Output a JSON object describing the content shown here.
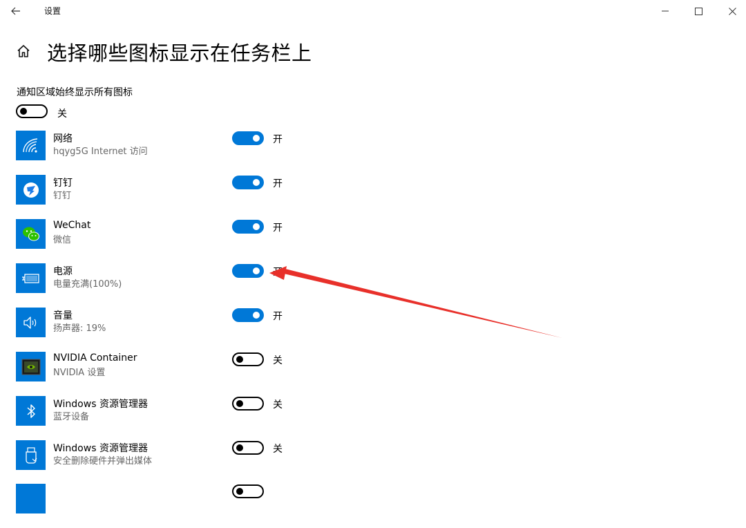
{
  "window": {
    "title": "设置",
    "controls": {
      "minimize": "minimize-icon",
      "maximize": "maximize-icon",
      "close": "close-icon"
    }
  },
  "header": {
    "title": "选择哪些图标显示在任务栏上",
    "home_icon": "home-icon"
  },
  "always_show": {
    "label": "通知区域始终显示所有图标",
    "state_label": "关",
    "on": false
  },
  "apps": [
    {
      "name": "网络",
      "description": "hqyg5G Internet 访问",
      "state_label": "开",
      "on": true,
      "icon": "wifi-icon"
    },
    {
      "name": "钉钉",
      "description": "钉钉",
      "state_label": "开",
      "on": true,
      "icon": "dingtalk-icon"
    },
    {
      "name": "WeChat",
      "description": "微信",
      "state_label": "开",
      "on": true,
      "icon": "wechat-icon"
    },
    {
      "name": "电源",
      "description": "电量充满(100%)",
      "state_label": "开",
      "on": true,
      "icon": "battery-icon"
    },
    {
      "name": "音量",
      "description": "扬声器: 19%",
      "state_label": "开",
      "on": true,
      "icon": "speaker-icon"
    },
    {
      "name": "NVIDIA Container",
      "description": "NVIDIA 设置",
      "state_label": "关",
      "on": false,
      "icon": "nvidia-icon"
    },
    {
      "name": "Windows 资源管理器",
      "description": "蓝牙设备",
      "state_label": "关",
      "on": false,
      "icon": "bluetooth-icon"
    },
    {
      "name": "Windows 资源管理器",
      "description": "安全删除硬件并弹出媒体",
      "state_label": "关",
      "on": false,
      "icon": "usb-drive-icon"
    }
  ],
  "colors": {
    "accent": "#0078d7",
    "annotation_arrow": "#e8302a"
  }
}
